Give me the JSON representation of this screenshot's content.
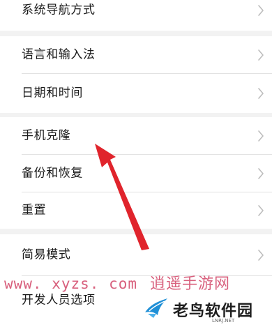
{
  "settings": {
    "items": [
      {
        "label": "系统导航方式"
      },
      {
        "label": "语言和输入法"
      },
      {
        "label": "日期和时间"
      },
      {
        "label": "手机克隆"
      },
      {
        "label": "备份和恢复"
      },
      {
        "label": "重置"
      },
      {
        "label": "简易模式"
      },
      {
        "label": "开发人员选项"
      }
    ]
  },
  "icons": {
    "chevron": "chevron-right-icon",
    "arrow": "red-pointer-arrow-icon",
    "logo": "bird-logo-icon"
  },
  "watermarks": {
    "site_url": "www. xyzs. com",
    "site_name": "逍遥手游网",
    "brand_name": "老鸟软件园",
    "brand_sub": "LNRJ.NET"
  },
  "colors": {
    "background": "#f2f2f2",
    "row_background": "#ffffff",
    "divider": "#e2e2e2",
    "arrow": "#e0242c",
    "watermark": "#d8607d",
    "chevron": "#bdbdbd"
  }
}
